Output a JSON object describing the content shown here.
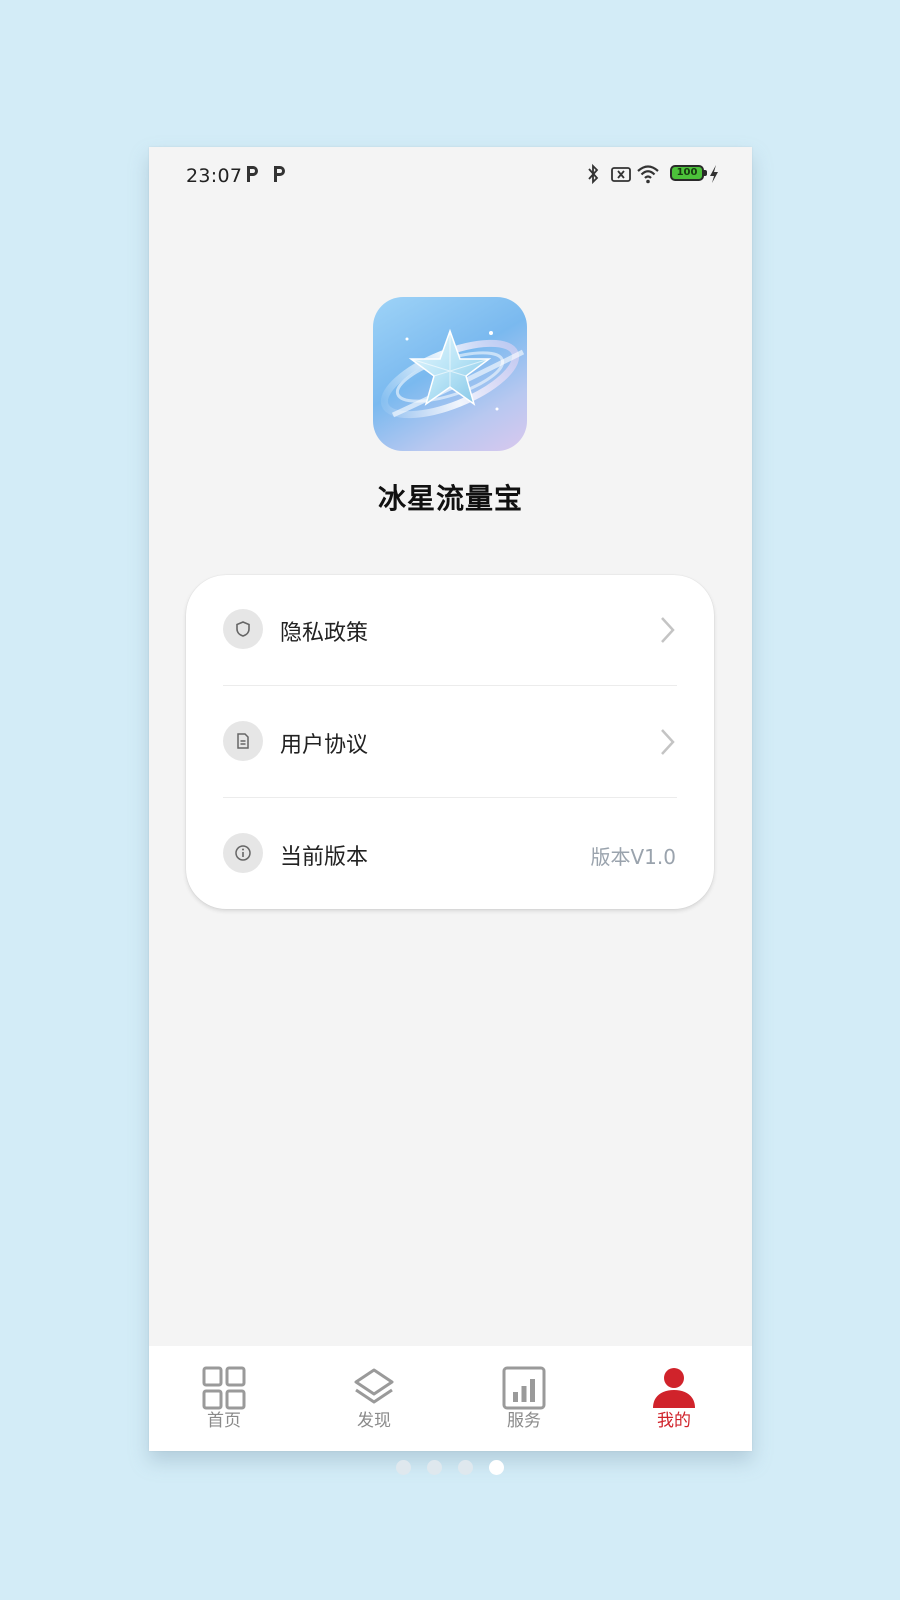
{
  "status_bar": {
    "time": "23:07",
    "battery": "100"
  },
  "app": {
    "name": "冰星流量宝"
  },
  "menu": {
    "items": [
      {
        "label": "隐私政策",
        "icon": "shield-icon",
        "has_chevron": true
      },
      {
        "label": "用户协议",
        "icon": "document-icon",
        "has_chevron": true
      },
      {
        "label": "当前版本",
        "icon": "info-icon",
        "value": "版本V1.0"
      }
    ]
  },
  "tabbar": {
    "tabs": [
      {
        "label": "首页",
        "icon": "grid-icon"
      },
      {
        "label": "发现",
        "icon": "layers-icon"
      },
      {
        "label": "服务",
        "icon": "chart-icon"
      },
      {
        "label": "我的",
        "icon": "user-icon",
        "active": true
      }
    ]
  },
  "pager": {
    "count": 4,
    "active_index": 3
  },
  "colors": {
    "accent": "#d0232b",
    "background": "#d3ecf7",
    "screen": "#f4f4f4"
  }
}
